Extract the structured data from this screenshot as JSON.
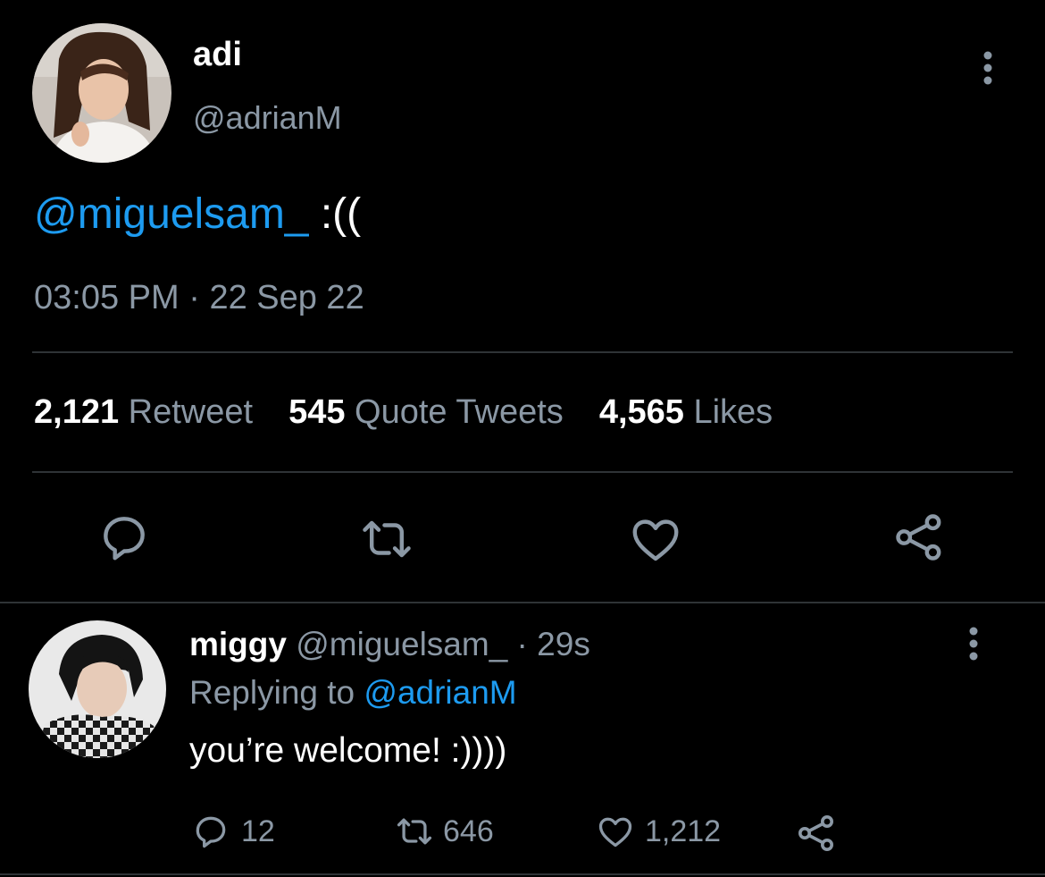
{
  "tweet": {
    "author": {
      "display_name": "adi",
      "handle": "@adrianM",
      "avatar": "avatar-adi"
    },
    "mention": "@miguelsam_",
    "text": " :((",
    "time": "03:05 PM",
    "separator": " · ",
    "date": "22 Sep 22",
    "stats": [
      {
        "count": "2,121",
        "label": "Retweet"
      },
      {
        "count": "545",
        "label": "Quote Tweets"
      },
      {
        "count": "4,565",
        "label": "Likes"
      }
    ],
    "actions": [
      "reply-icon",
      "retweet-icon",
      "like-icon",
      "share-icon"
    ]
  },
  "reply": {
    "author": {
      "display_name": "miggy",
      "handle": "@miguelsam_",
      "avatar": "avatar-miggy"
    },
    "time_sep": " · ",
    "time_ago": "29s",
    "replying_prefix": "Replying to ",
    "replying_to": "@adrianM",
    "text": "you’re welcome! :))))",
    "counts": {
      "replies": "12",
      "retweets": "646",
      "likes": "1,212"
    }
  },
  "colors": {
    "background": "#000000",
    "link": "#1d9bf0",
    "secondary_text": "#8b98a5",
    "divider": "#2f3336"
  }
}
